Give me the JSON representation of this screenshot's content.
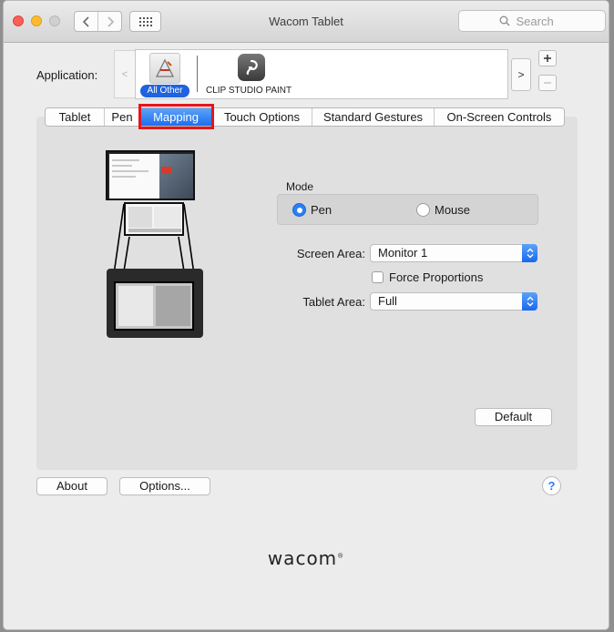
{
  "window": {
    "title": "Wacom Tablet",
    "search_placeholder": "Search"
  },
  "application": {
    "label": "Application:",
    "items": [
      {
        "name": "All Other",
        "selected": true
      },
      {
        "name": "CLIP STUDIO PAINT",
        "selected": false
      }
    ]
  },
  "tabs": [
    {
      "label": "Tablet",
      "selected": false
    },
    {
      "label": "Pen",
      "selected": false
    },
    {
      "label": "Mapping",
      "selected": true
    },
    {
      "label": "Touch Options",
      "selected": false
    },
    {
      "label": "Standard Gestures",
      "selected": false
    },
    {
      "label": "On-Screen Controls",
      "selected": false
    }
  ],
  "mapping": {
    "mode_label": "Mode",
    "mode_options": [
      "Pen",
      "Mouse"
    ],
    "mode_selected": "Pen",
    "screen_area_label": "Screen Area:",
    "screen_area_value": "Monitor 1",
    "force_proportions_label": "Force Proportions",
    "force_proportions_checked": false,
    "tablet_area_label": "Tablet Area:",
    "tablet_area_value": "Full",
    "default_button": "Default"
  },
  "footer": {
    "about_button": "About",
    "options_button": "Options...",
    "help_button": "?",
    "brand": "wacom"
  },
  "colors": {
    "accent_blue": "#1f63de",
    "tab_highlight_red": "#e4151d"
  }
}
